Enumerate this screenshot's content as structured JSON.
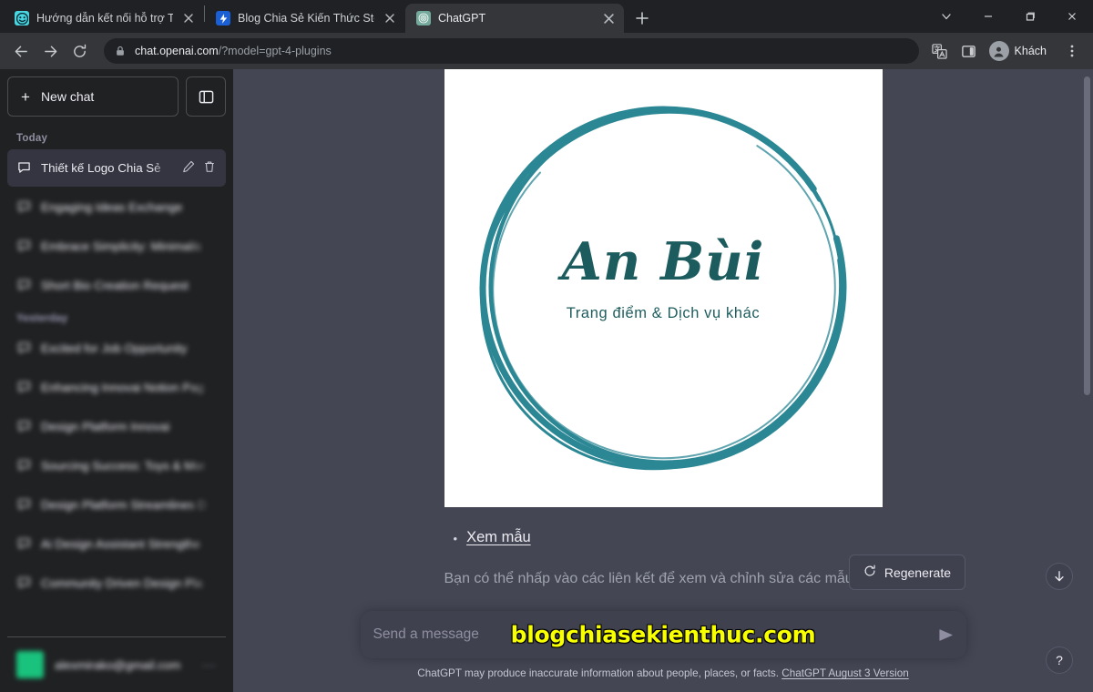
{
  "browser": {
    "tabs": [
      {
        "title": "Hướng dẫn kết nối hỗ trợ Teamvi",
        "favicon": "teamviewer-icon",
        "active": false
      },
      {
        "title": "Blog Chia Sẻ Kiến Thức Store - Sh",
        "favicon": "blog-icon",
        "active": false
      },
      {
        "title": "ChatGPT",
        "favicon": "chatgpt-icon",
        "active": true
      }
    ],
    "new_tab_label": "+",
    "window_controls": {
      "tab_search": "⌄",
      "minimize": "—",
      "maximize": "❐",
      "close": "✕"
    },
    "toolbar": {
      "back": "back-arrow",
      "forward": "forward-arrow",
      "reload": "reload",
      "lock": "lock-icon",
      "url_domain": "chat.openai.com",
      "url_path": "/?model=gpt-4-plugins",
      "translate": "translate-icon",
      "side_panel": "side-panel-icon",
      "profile_name": "Khách",
      "menu": "three-dot-menu"
    }
  },
  "sidebar": {
    "new_chat_label": "New chat",
    "new_chat_plus": "+",
    "collapse_label": "collapse-sidebar",
    "groups": [
      {
        "label": "Today",
        "blurred_label": false,
        "items": [
          {
            "title": "Thiết kế Logo Chia Sẻ",
            "active": true,
            "blurred": false
          },
          {
            "title": "Engaging Ideas Exchange",
            "active": false,
            "blurred": true
          },
          {
            "title": "Embrace Simplicity: Minimalis",
            "active": false,
            "blurred": true
          },
          {
            "title": "Short Bio Creation Request",
            "active": false,
            "blurred": true
          }
        ]
      },
      {
        "label": "Yesterday",
        "blurred_label": true,
        "items": [
          {
            "title": "Excited for Job Opportunity",
            "active": false,
            "blurred": true
          },
          {
            "title": "Enhancing Innovai Notion Pag",
            "active": false,
            "blurred": true
          },
          {
            "title": "Design Platform Innovai",
            "active": false,
            "blurred": true
          },
          {
            "title": "Sourcing Success: Toys & Mor",
            "active": false,
            "blurred": true
          },
          {
            "title": "Design Platform Streamlines D",
            "active": false,
            "blurred": true
          },
          {
            "title": "Ai Design Assistant Strengthe",
            "active": false,
            "blurred": true
          },
          {
            "title": "Community Driven Design Pla",
            "active": false,
            "blurred": true
          }
        ]
      }
    ],
    "account": {
      "email": "alexmirako@gmail.com",
      "avatar": "user-avatar",
      "more": "···"
    }
  },
  "conversation": {
    "logo_image": {
      "brand_name": "An Bùi",
      "tagline": "Trang điểm & Dịch vụ khác",
      "ring_color": "#2b8794",
      "text_color": "#1d5c5e",
      "background": "#ffffff"
    },
    "bullet_marker": "•",
    "sample_link_label": "Xem mẫu",
    "note": "Bạn có thể nhấp vào các liên kết để xem và chỉnh sửa các mẫu này",
    "regenerate_label": "Regenerate",
    "regenerate_icon": "refresh-icon"
  },
  "composer": {
    "placeholder": "Send a message",
    "send_icon": "send-arrow-icon",
    "watermark": "blogchiasekienthuc.com",
    "watermark_color": "#f7ff00"
  },
  "footer": {
    "disclaimer": "ChatGPT may produce inaccurate information about people, places, or facts.",
    "version_link": "ChatGPT August 3 Version"
  },
  "floating": {
    "scroll_down": "scroll-to-bottom",
    "help": "?"
  },
  "theme": {
    "sidebar_bg": "#202123",
    "main_bg": "#444654",
    "composer_bg": "#40414f",
    "accent_green": "#19c37d"
  }
}
